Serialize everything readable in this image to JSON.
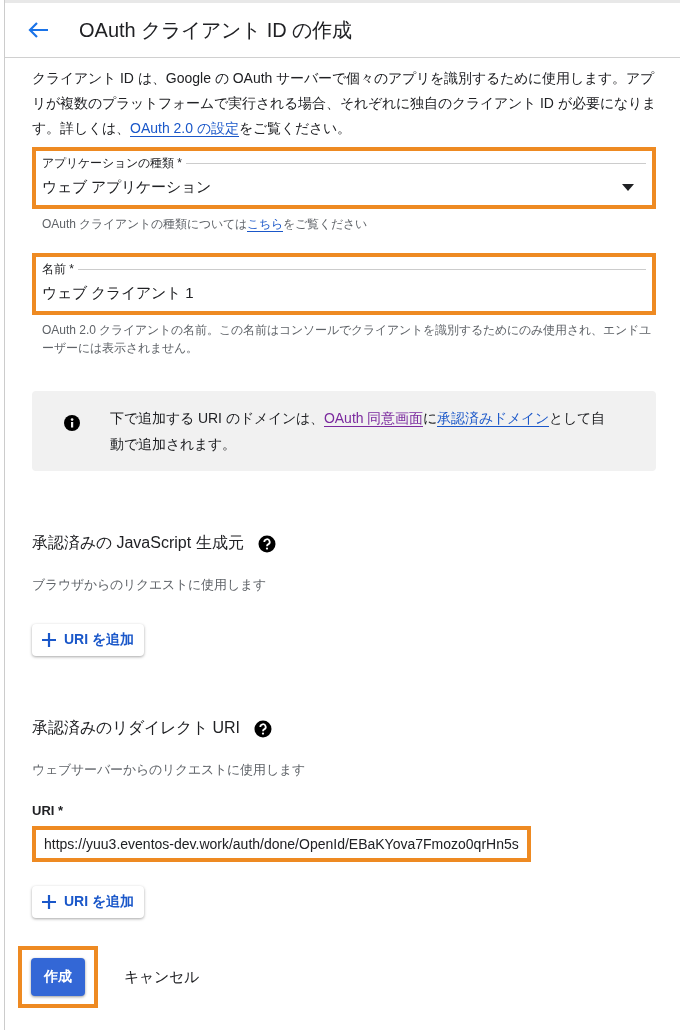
{
  "header": {
    "title": "OAuth クライアント ID の作成"
  },
  "intro": [
    {
      "kind": "text",
      "text": "クライアント ID は、Google の OAuth サーバーで個々のアプリを識別するために使用します。アプリが複数のプラットフォームで実行される場合、それぞれに独自のクライアント ID が必要になります。詳しくは、"
    },
    {
      "kind": "link",
      "text": "OAuth 2.0 の設定",
      "visited": false
    },
    {
      "kind": "text",
      "text": "をご覧ください。"
    }
  ],
  "fields": [
    {
      "kind": "select",
      "label": "アプリケーションの種類 *",
      "value": "ウェブ アプリケーション",
      "highlighted": true,
      "hint": [
        {
          "kind": "text",
          "text": "OAuth クライアントの種類については"
        },
        {
          "kind": "link",
          "text": "こちら",
          "visited": false
        },
        {
          "kind": "text",
          "text": "をご覧ください"
        }
      ]
    },
    {
      "kind": "text",
      "label": "名前 *",
      "value": "ウェブ クライアント 1",
      "highlighted": true,
      "hint": [
        {
          "kind": "text",
          "text": "OAuth 2.0 クライアントの名前。この名前はコンソールでクライアントを識別するためにのみ使用され、エンドユーザーには表示されません。"
        }
      ]
    }
  ],
  "notice": [
    {
      "kind": "text",
      "text": "下で追加する URI のドメインは、"
    },
    {
      "kind": "link",
      "text": "OAuth 同意画面",
      "visited": true
    },
    {
      "kind": "text",
      "text": "に"
    },
    {
      "kind": "link",
      "text": "承認済みドメイン",
      "visited": false
    },
    {
      "kind": "text",
      "text": "として自動で追加されます。"
    }
  ],
  "sections": [
    {
      "title": "承認済みの JavaScript 生成元",
      "description": "ブラウザからのリクエストに使用します",
      "add_button": "URI を追加"
    },
    {
      "title": "承認済みのリダイレクト URI",
      "description": "ウェブサーバーからのリクエストに使用します",
      "uris": [
        {
          "label": "URI *",
          "value": "https://yuu3.eventos-dev.work/auth/done/OpenId/EBaKYova7Fmozo0qrHn5s",
          "highlighted": true
        }
      ],
      "add_button": "URI を追加"
    }
  ],
  "actions": {
    "create": {
      "label": "作成",
      "highlighted": true
    },
    "cancel": "キャンセル"
  }
}
